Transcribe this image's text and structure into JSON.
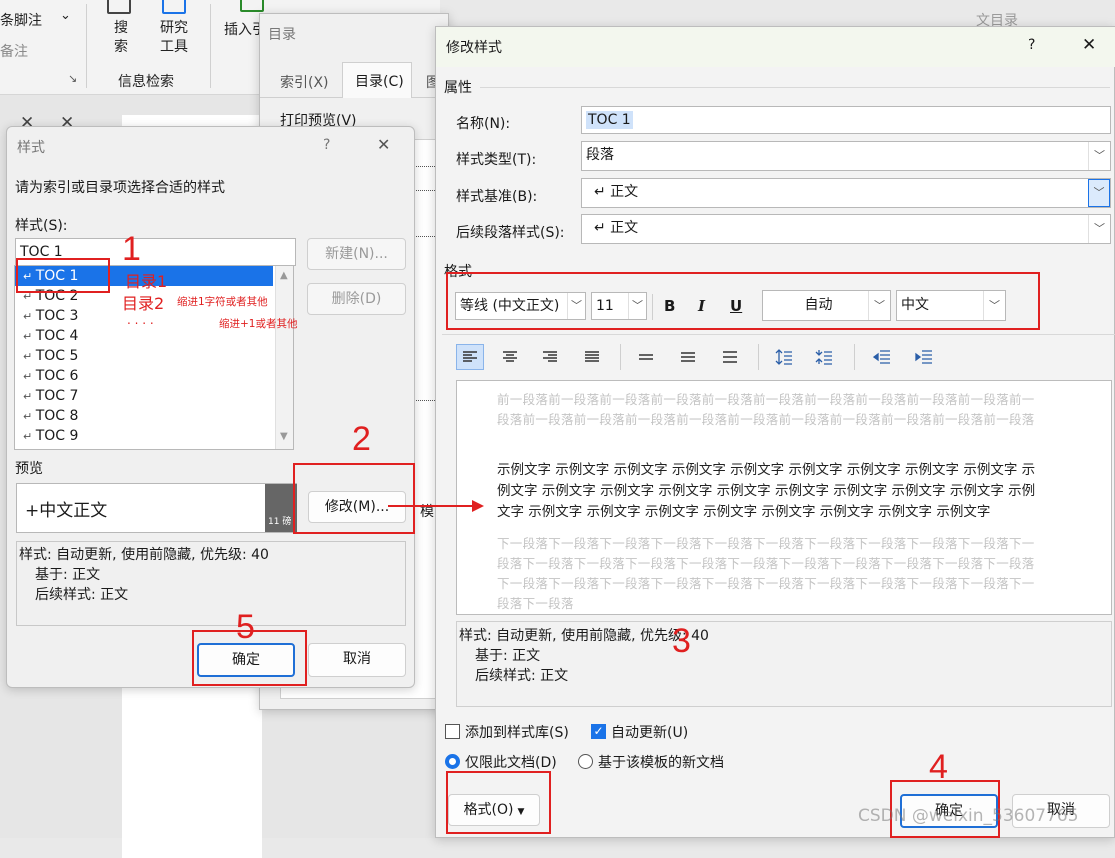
{
  "ribbon": {
    "footnote_group": "条脚注",
    "footnote_arrow": "⌄",
    "notes": "备注",
    "search": "搜\n索",
    "research_tools": "研究\n工具",
    "insert": "插入引",
    "info_search": "信息检索",
    "toc_caption": "文目录"
  },
  "toc_dialog": {
    "title": "目录",
    "tabs": [
      "索引(X)",
      "目录(C)",
      "图"
    ],
    "print_preview": "打印预览(V)",
    "template_btn": "模"
  },
  "style_dialog": {
    "title": "样式",
    "help": "?",
    "close": "✕",
    "prompt": "请为索引或目录项选择合适的样式",
    "styles_label": "样式(S):",
    "style_input": "TOC 1",
    "style_items": [
      "TOC 1",
      "TOC 2",
      "TOC 3",
      "TOC 4",
      "TOC 5",
      "TOC 6",
      "TOC 7",
      "TOC 8",
      "TOC 9"
    ],
    "new_btn": "新建(N)...",
    "delete_btn": "删除(D)",
    "preview_label": "预览",
    "preview_text": "+中文正文",
    "preview_size": "11 磅",
    "modify_btn": "修改(M)...",
    "desc_lines": [
      "样式: 自动更新, 使用前隐藏, 优先级: 40",
      "基于: 正文",
      "后续样式: 正文"
    ],
    "ok": "确定",
    "cancel": "取消"
  },
  "modify_dialog": {
    "title": "修改样式",
    "help": "?",
    "close": "✕",
    "section_props": "属性",
    "name_label": "名称(N):",
    "name_value": "TOC 1",
    "type_label": "样式类型(T):",
    "type_value": "段落",
    "based_label": "样式基准(B):",
    "based_value": "↵ 正文",
    "next_label": "后续段落样式(S):",
    "next_value": "↵ 正文",
    "section_format": "格式",
    "font": "等线 (中文正文)",
    "size": "11",
    "bold": "B",
    "italic": "I",
    "underline": "U",
    "color": "自动",
    "lang": "中文",
    "prev_para": "前一段落前一段落前一段落前一段落前一段落前一段落前一段落前一段落前一段落前一段落前一段落前一段落前一段落前一段落前一段落前一段落前一段落前一段落前一段落前一段落前一段落",
    "sample_text": "示例文字 示例文字 示例文字 示例文字 示例文字 示例文字 示例文字 示例文字 示例文字 示例文字 示例文字 示例文字 示例文字 示例文字 示例文字 示例文字 示例文字 示例文字 示例文字 示例文字 示例文字 示例文字 示例文字 示例文字 示例文字 示例文字 示例文字",
    "next_para": "下一段落下一段落下一段落下一段落下一段落下一段落下一段落下一段落下一段落下一段落下一段落下一段落下一段落下一段落下一段落下一段落下一段落下一段落下一段落下一段落下一段落下一段落下一段落下一段落下一段落下一段落下一段落下一段落下一段落下一段落下一段落下一段落下一段落",
    "desc_lines": [
      "样式: 自动更新, 使用前隐藏, 优先级: 40",
      "基于: 正文",
      "后续样式: 正文"
    ],
    "add_to_gallery": "添加到样式库(S)",
    "auto_update": "自动更新(U)",
    "only_this_doc": "仅限此文档(D)",
    "new_docs_template": "基于该模板的新文档",
    "format_btn": "格式(O)",
    "ok": "确定",
    "cancel": "取消"
  },
  "annotations": {
    "n1": "1",
    "n2": "2",
    "n3": "3",
    "n4": "4",
    "n5": "5",
    "toc1": "目录1",
    "toc2": "目录2",
    "note_a": "缩进1字符或者其他",
    "dots": ". . . .",
    "note_b": "缩进+1或者其他"
  },
  "watermark": "CSDN @weixin_53607765",
  "colors": {
    "accent": "#1a73e8",
    "annotation": "#e02020"
  }
}
